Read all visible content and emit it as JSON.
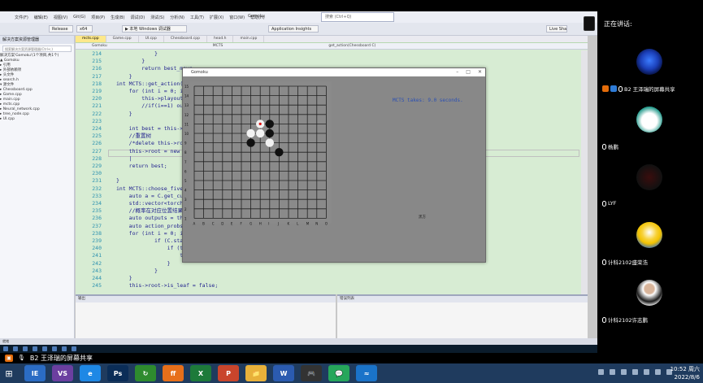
{
  "vs": {
    "menu": [
      "文件(F)",
      "编辑(E)",
      "视图(V)",
      "Git(G)",
      "项目(P)",
      "生成(B)",
      "调试(D)",
      "测试(S)",
      "分析(N)",
      "工具(T)",
      "扩展(X)",
      "窗口(W)",
      "帮助(H)"
    ],
    "search_placeholder": "搜索 (Ctrl+Q)",
    "window_title": "Gomoku",
    "toolbar": {
      "config": "Release",
      "platform": "x64",
      "run": "▶ 本地 Windows 调试器",
      "profile": "Application Insights"
    },
    "live_share": "Live Share",
    "solution": {
      "header": "解决方案资源管理器",
      "search": "搜索解决方案资源管理器(Ctrl+;)",
      "items": [
        "解决方案'Gomoku'(1个项目,共1个)",
        "▲ Gomoku",
        "  ▸ 引用",
        "  ▸ 外部依赖项",
        "  ▸ 头文件",
        "    ▸ search.h",
        "  ▾ 源文件",
        "    ▸ Chessboard.cpp",
        "    ▸ Game.cpp",
        "    ▸ main.cpp",
        "    ▸ mcts.cpp",
        "    ▸ Neural_network.cpp",
        "    ▸ tree_node.cpp",
        "    ▸ UI.cpp"
      ]
    },
    "tabs": [
      "mcts.cpp",
      "Game.cpp",
      "UI.cpp",
      "Chessboard.cpp",
      "head.h",
      "main.cpp"
    ],
    "nav": [
      "Gomoku",
      "MCTS",
      "get_action(Chessboard C)"
    ],
    "code_lines": [
      {
        "n": "214",
        "t": "            }"
      },
      {
        "n": "215",
        "t": "        }"
      },
      {
        "n": "216",
        "t": "        return best_move;"
      },
      {
        "n": "217",
        "t": "    }"
      },
      {
        "n": "218",
        "t": "int MCTS::get_action(C"
      },
      {
        "n": "219",
        "t": "    for (int i = 0; i"
      },
      {
        "n": "220",
        "t": "        this->playout(C"
      },
      {
        "n": "221",
        "t": "        //if(i==1) out"
      },
      {
        "n": "222",
        "t": "    }"
      },
      {
        "n": "223",
        "t": ""
      },
      {
        "n": "224",
        "t": "    int best = this->g"
      },
      {
        "n": "225",
        "t": "    //重置树"
      },
      {
        "n": "226",
        "t": "    /*delete this->roo"
      },
      {
        "n": "227",
        "t": "    this->root = new T"
      },
      {
        "n": "228",
        "t": "    |"
      },
      {
        "n": "229",
        "t": "    return best;"
      },
      {
        "n": "230",
        "t": ""
      },
      {
        "n": "231",
        "t": "}"
      },
      {
        "n": "232",
        "t": "int MCTS::choose_five("
      },
      {
        "n": "233",
        "t": "    auto a = C.get_cur"
      },
      {
        "n": "234",
        "t": "    std::vector<torch:"
      },
      {
        "n": "235",
        "t": "    //概率在对应位置结果"
      },
      {
        "n": "236",
        "t": "    auto outputs = thi"
      },
      {
        "n": "237",
        "t": "    auto action_probs"
      },
      {
        "n": "238",
        "t": "    for (int i = 0; i"
      },
      {
        "n": "239",
        "t": "            if (C.stat"
      },
      {
        "n": "240",
        "t": "                if (th"
      },
      {
        "n": "241",
        "t": "                    th                                                                    t());"
      },
      {
        "n": "242",
        "t": "                }"
      },
      {
        "n": "243",
        "t": "            }"
      },
      {
        "n": "244",
        "t": "    }"
      },
      {
        "n": "245",
        "t": "    this->root->is_leaf = false;"
      }
    ],
    "output_header": "输出",
    "errors_header": "错误列表",
    "status": "就绪"
  },
  "gomoku": {
    "title": "Gomoku",
    "message": "MCTS takes: 9.0 seconds.",
    "turn_label": "黑方",
    "row_labels": [
      "15",
      "14",
      "13",
      "12",
      "11",
      "10",
      "9",
      "8",
      "7",
      "6",
      "5",
      "4",
      "3",
      "2",
      "1"
    ],
    "col_labels": [
      "A",
      "B",
      "C",
      "D",
      "E",
      "F",
      "G",
      "H",
      "I",
      "J",
      "K",
      "L",
      "M",
      "N",
      "O"
    ],
    "stones": [
      {
        "col": 8,
        "row": 10,
        "color": "black"
      },
      {
        "col": 7,
        "row": 10,
        "color": "white",
        "last": true
      },
      {
        "col": 6,
        "row": 9,
        "color": "white"
      },
      {
        "col": 7,
        "row": 9,
        "color": "white"
      },
      {
        "col": 8,
        "row": 9,
        "color": "black"
      },
      {
        "col": 6,
        "row": 8,
        "color": "black"
      },
      {
        "col": 8,
        "row": 8,
        "color": "white"
      },
      {
        "col": 9,
        "row": 7,
        "color": "black"
      }
    ]
  },
  "meeting": {
    "speaking_label": "正在讲话:",
    "participants": [
      {
        "name": "B2 王泽瑞的屏幕共享",
        "avatar": "blue-orb",
        "host": true
      },
      {
        "name": "杨鹏",
        "avatar": "panda"
      },
      {
        "name": "LYF",
        "avatar": "dark"
      },
      {
        "name": "计科2102盛荣浩",
        "avatar": "minion"
      },
      {
        "name": "计科2102许志鹏",
        "avatar": "person"
      }
    ],
    "share_label": "B2 王泽瑞的屏幕共享"
  },
  "taskbar": {
    "apps": [
      "IE",
      "VS",
      "e",
      "Ps",
      "↻",
      "ff",
      "X",
      "P",
      "📁",
      "W",
      "🎮",
      "💬",
      "≈"
    ],
    "time": "10:52 周六",
    "date": "2022/8/6"
  }
}
